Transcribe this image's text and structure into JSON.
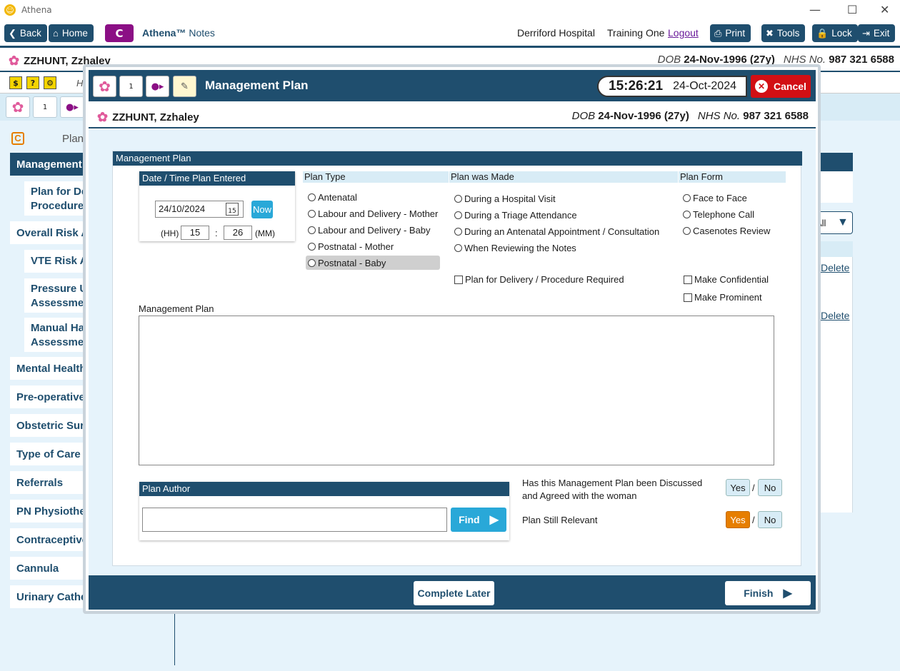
{
  "window": {
    "title": "Athena"
  },
  "toolbar": {
    "back": "Back",
    "home": "Home",
    "badge": "C",
    "brand": "Athena™",
    "brand_suffix": "Notes",
    "hospital": "Derriford Hospital",
    "user": "Training One",
    "logout": "Logout",
    "print": "Print",
    "tools": "Tools",
    "lock": "Lock",
    "exit": "Exit"
  },
  "patient": {
    "name": "ZZHUNT, Zzhaley",
    "dob_label": "DOB",
    "dob": "24-Nov-1996 (27y)",
    "nhs_label": "NHS No.",
    "nhs": "987 321 6588"
  },
  "background": {
    "sub_h": "H",
    "plan_label": "Plan",
    "all": "All",
    "delete": "Delete",
    "nav": [
      "Management",
      "Plan for De",
      "Procedure",
      "Overall Risk A",
      "VTE Risk As",
      "Pressure Ul",
      "Assessmen",
      "Manual Ha",
      "Assessmen",
      "Mental Health",
      "Pre-operative",
      "Obstetric Surg",
      "Type of Care",
      "Referrals",
      "PN Physiother",
      "Contraceptive",
      "Cannula",
      "Urinary Cathe"
    ]
  },
  "modal": {
    "title": "Management Plan",
    "time": "15:26:21",
    "date": "24-Oct-2024",
    "cancel": "Cancel",
    "section_title": "Management Plan",
    "datetime": {
      "header": "Date / Time Plan Entered",
      "date_value": "24/10/2024",
      "cal_day": "15",
      "now": "Now",
      "hh_label": "(HH)",
      "hh": "15",
      "sep": ":",
      "mm": "26",
      "mm_label": "(MM)"
    },
    "plan_type": {
      "header": "Plan Type",
      "options": [
        "Antenatal",
        "Labour and Delivery - Mother",
        "Labour and Delivery - Baby",
        "Postnatal - Mother",
        "Postnatal - Baby"
      ]
    },
    "plan_made": {
      "header": "Plan was Made",
      "options": [
        "During a Hospital Visit",
        "During a Triage Attendance",
        "During an Antenatal Appointment / Consultation",
        "When Reviewing the Notes"
      ],
      "delivery_check": "Plan for Delivery / Procedure Required"
    },
    "plan_form": {
      "header": "Plan Form",
      "options": [
        "Face to Face",
        "Telephone Call",
        "Casenotes Review"
      ],
      "confidential": "Make Confidential",
      "prominent": "Make Prominent"
    },
    "plan_text_label": "Management Plan",
    "author": {
      "header": "Plan Author",
      "find": "Find"
    },
    "discussed": {
      "question": "Has this Management Plan been Discussed and Agreed with the woman",
      "yes": "Yes",
      "slash": "/",
      "no": "No"
    },
    "relevant": {
      "question": "Plan Still Relevant",
      "yes": "Yes",
      "slash": "/",
      "no": "No"
    },
    "complete_later": "Complete Later",
    "finish": "Finish"
  }
}
